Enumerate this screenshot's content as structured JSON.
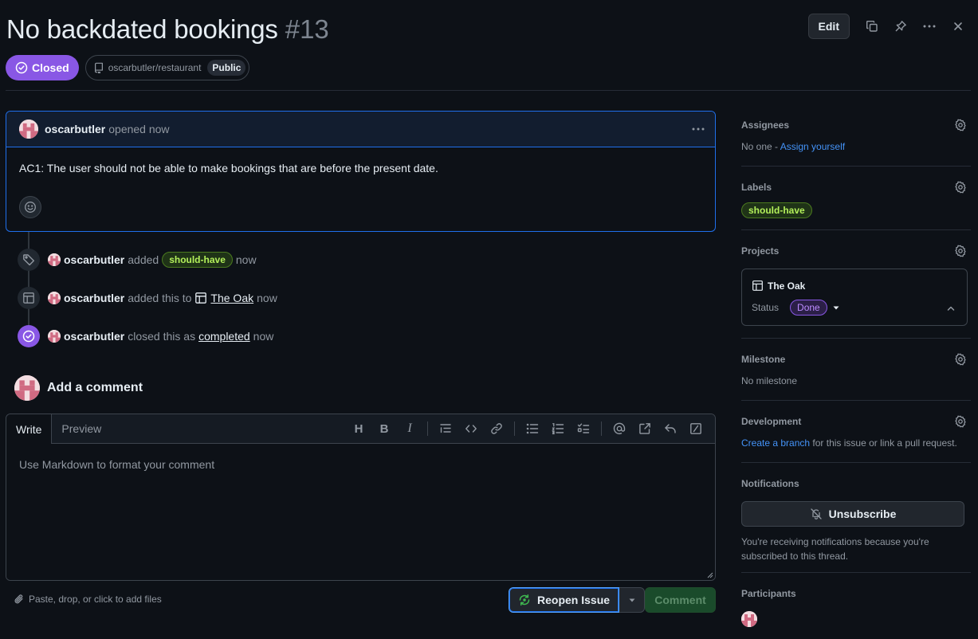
{
  "issue": {
    "title": "No backdated bookings",
    "number": "#13",
    "state": "Closed",
    "repo": "oscarbutler/restaurant",
    "visibility": "Public"
  },
  "header_actions": {
    "edit_label": "Edit"
  },
  "comment": {
    "author": "oscarbutler",
    "meta": "opened now",
    "body": "AC1: The user should not be able to make bookings that are before the present date."
  },
  "timeline": [
    {
      "author": "oscarbutler",
      "text": "added",
      "label": "should-have",
      "time": "now"
    },
    {
      "author": "oscarbutler",
      "text": "added this to",
      "link": "The Oak",
      "time": "now"
    },
    {
      "author": "oscarbutler",
      "text": "closed this as",
      "link": "completed",
      "time": "now"
    }
  ],
  "add_comment": {
    "title": "Add a comment",
    "tab_write": "Write",
    "tab_preview": "Preview",
    "toolbar_heading": "H",
    "toolbar_bold": "B",
    "toolbar_italic": "I",
    "placeholder": "Use Markdown to format your comment",
    "attach_text": "Paste, drop, or click to add files",
    "reopen_label": "Reopen Issue",
    "comment_label": "Comment"
  },
  "sidebar": {
    "assignees": {
      "title": "Assignees",
      "text": "No one - ",
      "link": "Assign yourself"
    },
    "labels": {
      "title": "Labels",
      "label": "should-have"
    },
    "projects": {
      "title": "Projects",
      "project_name": "The Oak",
      "status_label": "Status",
      "status_value": "Done"
    },
    "milestone": {
      "title": "Milestone",
      "text": "No milestone"
    },
    "development": {
      "title": "Development",
      "link": "Create a branch",
      "text": " for this issue or link a pull request."
    },
    "notifications": {
      "title": "Notifications",
      "button": "Unsubscribe",
      "text": "You're receiving notifications because you're subscribed to this thread."
    },
    "participants": {
      "title": "Participants"
    }
  },
  "colors": {
    "background": "#0d1117",
    "closed_purple": "#8957e5",
    "label_green": "#b3f05b",
    "link_blue": "#4493f8",
    "comment_green": "#1a4b2b"
  },
  "icons": [
    "copy-icon",
    "pin-icon",
    "kebab-icon",
    "close-icon",
    "repo-icon",
    "smiley-icon",
    "tag-icon",
    "table-icon",
    "check-circle-icon",
    "paperclip-icon",
    "sync-icon",
    "gear-icon",
    "bell-slash-icon",
    "chevron-up-icon",
    "triangle-down-icon"
  ]
}
